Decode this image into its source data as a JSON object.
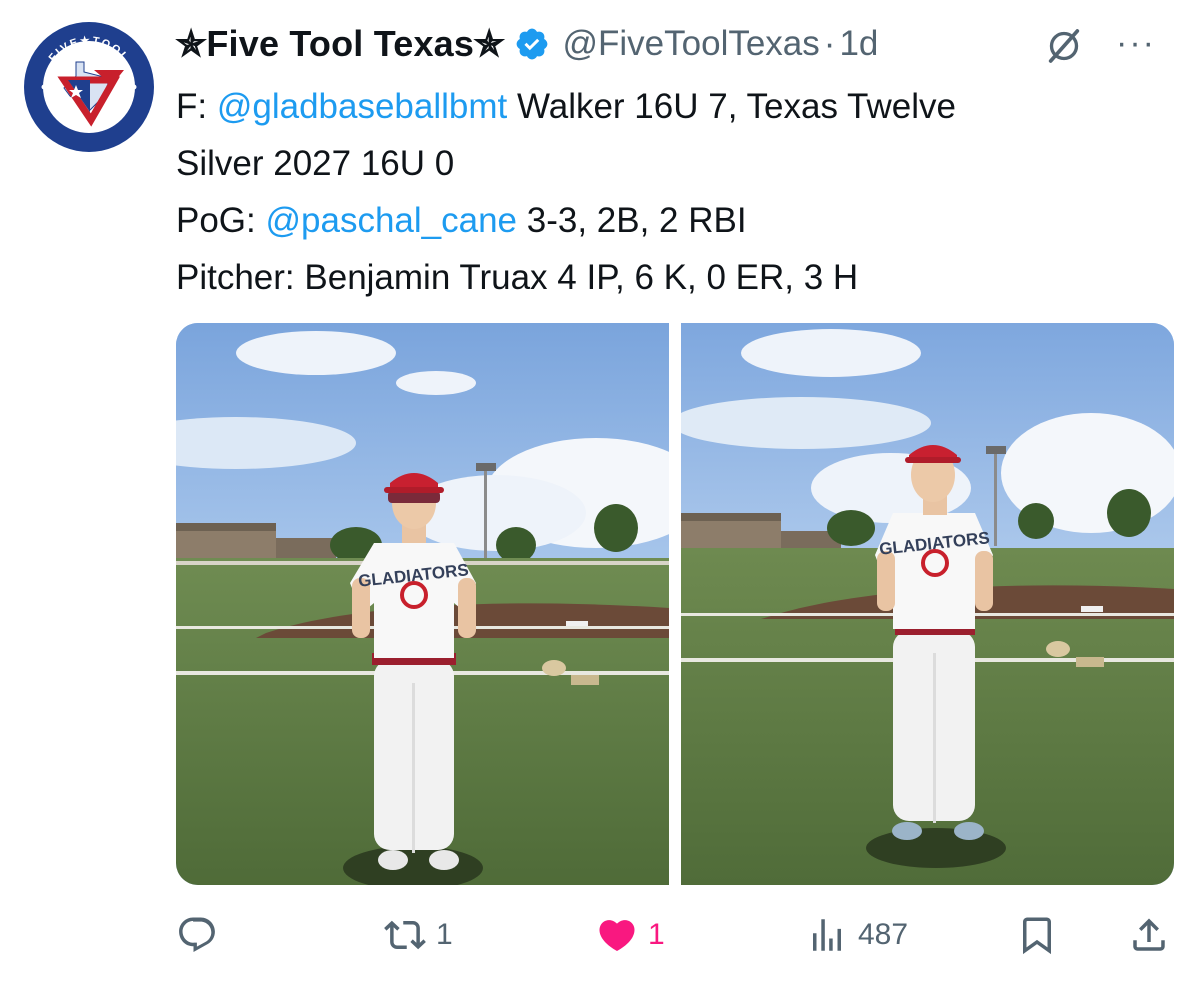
{
  "tweet": {
    "display_name": "✯Five Tool Texas✯",
    "handle": "@FiveToolTexas",
    "separator": "·",
    "time": "1d",
    "more_label": "···",
    "lines": [
      {
        "mention": "",
        "prefix": "F: ",
        "handle": "@gladbaseballbmt",
        "rest": " Walker 16U 7, Texas Twelve"
      },
      {
        "prefix": "Silver 2027 16U 0"
      },
      {
        "prefix": "PoG: ",
        "handle": "@paschal_cane",
        "rest": " 3-3, 2B, 2 RBI"
      },
      {
        "prefix": "Pitcher: Benjamin Truax 4 IP, 6 K, 0 ER, 3 H"
      }
    ],
    "avatar_text": {
      "top": "FIVE TOOL",
      "bottom": "TEXAS"
    }
  },
  "actions": {
    "reply": {
      "icon": "reply-icon",
      "count": ""
    },
    "retweet": {
      "icon": "retweet-icon",
      "count": "1"
    },
    "like": {
      "icon": "heart-icon",
      "count": "1"
    },
    "views": {
      "icon": "views-icon",
      "count": "487"
    },
    "bookmark": {
      "icon": "bookmark-icon"
    },
    "share": {
      "icon": "share-icon"
    }
  },
  "colors": {
    "accent": "#1d9bf0",
    "like": "#f91880",
    "muted": "#536471",
    "text": "#0f1419"
  },
  "media": {
    "photos": [
      {
        "shirt_text": "GLADIATORS"
      },
      {
        "shirt_text": "GLADIATORS"
      }
    ]
  }
}
